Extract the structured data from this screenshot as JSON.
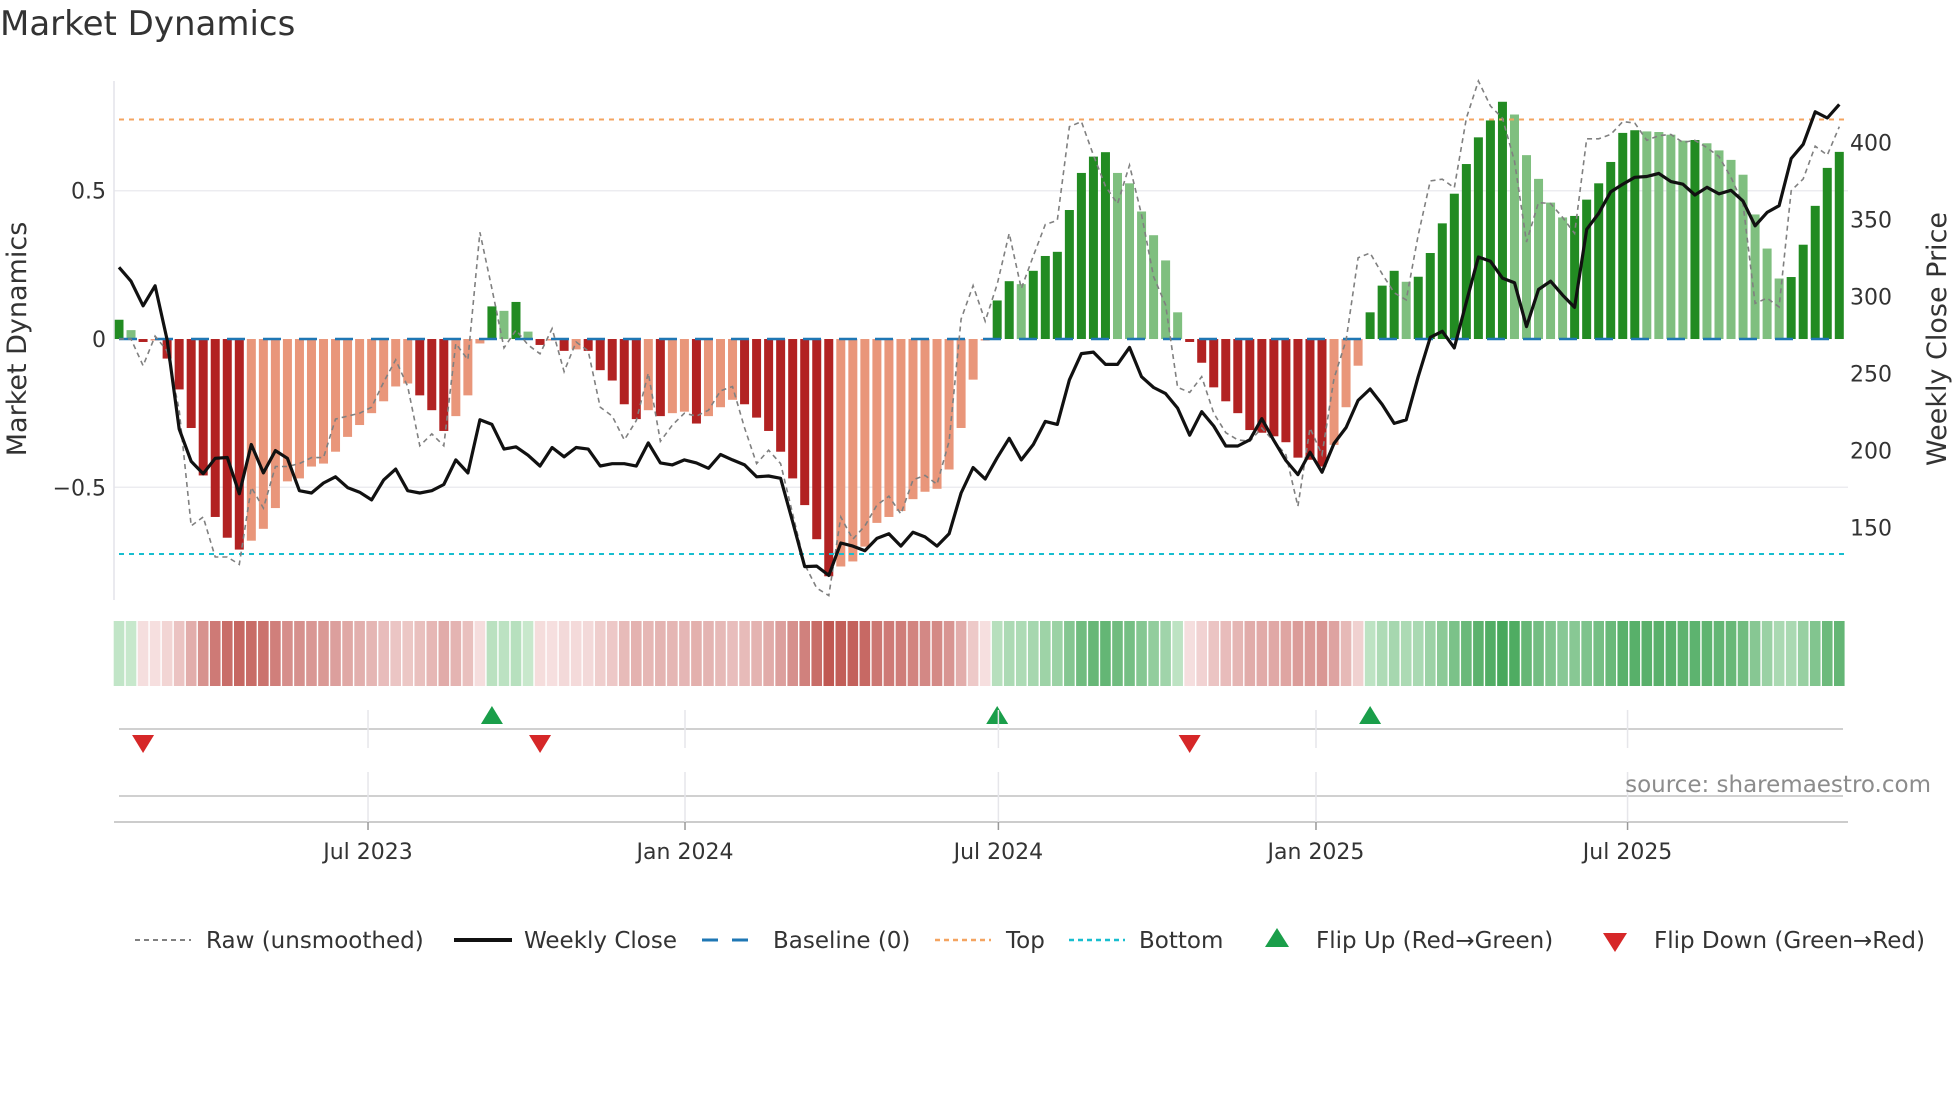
{
  "chart_data": {
    "type": "bar",
    "title": "Market Dynamics",
    "ylabel_left": "Market Dynamics",
    "ylabel_right": "Weekly Close Price",
    "ylim_left": [
      -0.88,
      0.87
    ],
    "ylim_right": [
      103,
      440
    ],
    "grid": true,
    "left_ticks": [
      {
        "value": 0.5,
        "label": "0.5"
      },
      {
        "value": 0,
        "label": "0"
      },
      {
        "value": -0.5,
        "label": "−0.5"
      }
    ],
    "right_ticks": [
      {
        "value": 400,
        "label": "400"
      },
      {
        "value": 350,
        "label": "350"
      },
      {
        "value": 300,
        "label": "300"
      },
      {
        "value": 250,
        "label": "250"
      },
      {
        "value": 200,
        "label": "200"
      },
      {
        "value": 150,
        "label": "150"
      }
    ],
    "x_unit": "week index",
    "x_ticks": [
      {
        "week": 20.7,
        "label": "Jul 2023"
      },
      {
        "week": 47.05,
        "label": "Jan 2024"
      },
      {
        "week": 73.1,
        "label": "Jul 2024"
      },
      {
        "week": 99.5,
        "label": "Jan 2025"
      },
      {
        "week": 125.4,
        "label": "Jul 2025"
      }
    ],
    "top_level": 0.74,
    "bottom_level": -0.725,
    "baseline": 0,
    "smoothed": [
      0.065,
      0.03,
      -0.01,
      -0.005,
      -0.066,
      -0.17,
      -0.3,
      -0.46,
      -0.6,
      -0.67,
      -0.71,
      -0.68,
      -0.64,
      -0.57,
      -0.48,
      -0.47,
      -0.43,
      -0.42,
      -0.38,
      -0.33,
      -0.29,
      -0.25,
      -0.21,
      -0.16,
      -0.15,
      -0.19,
      -0.24,
      -0.31,
      -0.26,
      -0.19,
      -0.015,
      0.11,
      0.095,
      0.125,
      0.025,
      -0.02,
      -0.005,
      -0.04,
      -0.035,
      -0.04,
      -0.105,
      -0.14,
      -0.22,
      -0.27,
      -0.24,
      -0.26,
      -0.25,
      -0.245,
      -0.285,
      -0.26,
      -0.23,
      -0.205,
      -0.22,
      -0.265,
      -0.31,
      -0.38,
      -0.47,
      -0.56,
      -0.675,
      -0.8,
      -0.767,
      -0.75,
      -0.7,
      -0.62,
      -0.6,
      -0.58,
      -0.54,
      -0.515,
      -0.505,
      -0.44,
      -0.3,
      -0.137,
      -0.005,
      0.13,
      0.195,
      0.185,
      0.23,
      0.28,
      0.294,
      0.435,
      0.56,
      0.615,
      0.63,
      0.56,
      0.525,
      0.43,
      0.35,
      0.265,
      0.09,
      -0.01,
      -0.08,
      -0.163,
      -0.21,
      -0.25,
      -0.307,
      -0.316,
      -0.328,
      -0.348,
      -0.4,
      -0.407,
      -0.43,
      -0.357,
      -0.23,
      -0.09,
      0.09,
      0.18,
      0.23,
      0.193,
      0.21,
      0.29,
      0.39,
      0.49,
      0.59,
      0.68,
      0.737,
      0.8,
      0.757,
      0.62,
      0.54,
      0.46,
      0.41,
      0.415,
      0.47,
      0.525,
      0.597,
      0.695,
      0.704,
      0.7,
      0.698,
      0.689,
      0.669,
      0.671,
      0.66,
      0.636,
      0.604,
      0.554,
      0.42,
      0.305,
      0.204,
      0.209,
      0.318,
      0.449,
      0.577,
      0.631
    ],
    "raw": [
      0.0,
      0.0,
      -0.09,
      0.01,
      -0.04,
      -0.24,
      -0.63,
      -0.6,
      -0.735,
      -0.735,
      -0.76,
      -0.5,
      -0.57,
      -0.43,
      -0.43,
      -0.42,
      -0.4,
      -0.4,
      -0.27,
      -0.26,
      -0.25,
      -0.23,
      -0.145,
      -0.07,
      -0.16,
      -0.36,
      -0.32,
      -0.36,
      -0.015,
      -0.07,
      0.36,
      0.17,
      -0.03,
      0.03,
      -0.02,
      -0.05,
      0.035,
      -0.11,
      -0.01,
      -0.04,
      -0.23,
      -0.26,
      -0.34,
      -0.275,
      -0.115,
      -0.345,
      -0.29,
      -0.25,
      -0.26,
      -0.24,
      -0.175,
      -0.16,
      -0.3,
      -0.42,
      -0.375,
      -0.42,
      -0.59,
      -0.76,
      -0.84,
      -0.865,
      -0.6,
      -0.675,
      -0.63,
      -0.56,
      -0.53,
      -0.59,
      -0.475,
      -0.46,
      -0.49,
      -0.345,
      0.067,
      0.18,
      0.06,
      0.185,
      0.356,
      0.17,
      0.28,
      0.386,
      0.4,
      0.716,
      0.733,
      0.62,
      0.515,
      0.456,
      0.586,
      0.42,
      0.21,
      0.115,
      -0.163,
      -0.18,
      -0.127,
      -0.25,
      -0.316,
      -0.34,
      -0.345,
      -0.3,
      -0.345,
      -0.39,
      -0.564,
      -0.3,
      -0.39,
      -0.133,
      -0.004,
      0.274,
      0.29,
      0.22,
      0.156,
      0.132,
      0.35,
      0.533,
      0.539,
      0.51,
      0.745,
      0.87,
      0.786,
      0.745,
      0.6,
      0.327,
      0.46,
      0.457,
      0.41,
      0.356,
      0.675,
      0.675,
      0.69,
      0.733,
      0.728,
      0.67,
      0.686,
      0.69,
      0.663,
      0.67,
      0.645,
      0.615,
      0.545,
      0.456,
      0.12,
      0.138,
      0.108,
      0.5,
      0.54,
      0.65,
      0.62,
      0.716
    ],
    "weekly_close": [
      319,
      310,
      294,
      307,
      272,
      214,
      193,
      185,
      195,
      195.5,
      172,
      204,
      185.5,
      200,
      195,
      174,
      172.5,
      179,
      183,
      176,
      173,
      168,
      181,
      188,
      174,
      172.5,
      174,
      178,
      194,
      185.5,
      220,
      217,
      201,
      202.5,
      197,
      190,
      202,
      196,
      202,
      201,
      190,
      191.5,
      191.5,
      190,
      205,
      192,
      190.7,
      194,
      192,
      188.5,
      197.5,
      194,
      190.7,
      183,
      183.5,
      182,
      153.7,
      124.7,
      125,
      119,
      140,
      138,
      135,
      143,
      146,
      138,
      147,
      144,
      138,
      146,
      172.5,
      189,
      181.6,
      195.4,
      208,
      194,
      204,
      219,
      217,
      246,
      263,
      264,
      256,
      256,
      267,
      248,
      241,
      237,
      227.6,
      210,
      225.3,
      216,
      203,
      203,
      207,
      220.7,
      206.5,
      193.6,
      184.4,
      199,
      186,
      204.6,
      215,
      232.6,
      240,
      230,
      217.7,
      220,
      248,
      273.6,
      277.5,
      266.7,
      296.6,
      325.7,
      323,
      312,
      309,
      280.5,
      304.6,
      310,
      301,
      293,
      343.7,
      354,
      368,
      373,
      377.5,
      378,
      380,
      374.7,
      373,
      366,
      371,
      366.7,
      369,
      362,
      346,
      354.7,
      359,
      389.7,
      398.9,
      420,
      416,
      424.8
    ],
    "colors": {
      "pos_rising": "#228b22",
      "pos_falling": "#7fbf7f",
      "neg_falling": "#b22222",
      "neg_rising": "#e9967a",
      "close": "#111111",
      "raw": "#808080",
      "baseline": "#1f77b4",
      "top": "#f4a460",
      "bottom": "#17becf",
      "flip_up": "#1a9e4a",
      "flip_down": "#d62728"
    },
    "legend_position": "bottom",
    "legend": [
      {
        "label": "Raw (unsmoothed)",
        "kind": "raw"
      },
      {
        "label": "Weekly Close",
        "kind": "close"
      },
      {
        "label": "Baseline (0)",
        "kind": "baseline"
      },
      {
        "label": "Top",
        "kind": "top"
      },
      {
        "label": "Bottom",
        "kind": "bottom"
      },
      {
        "label": "Flip Up (Red→Green)",
        "kind": "flip_up"
      },
      {
        "label": "Flip Down (Green→Red)",
        "kind": "flip_down"
      }
    ],
    "source": "source: sharemaestro.com"
  }
}
